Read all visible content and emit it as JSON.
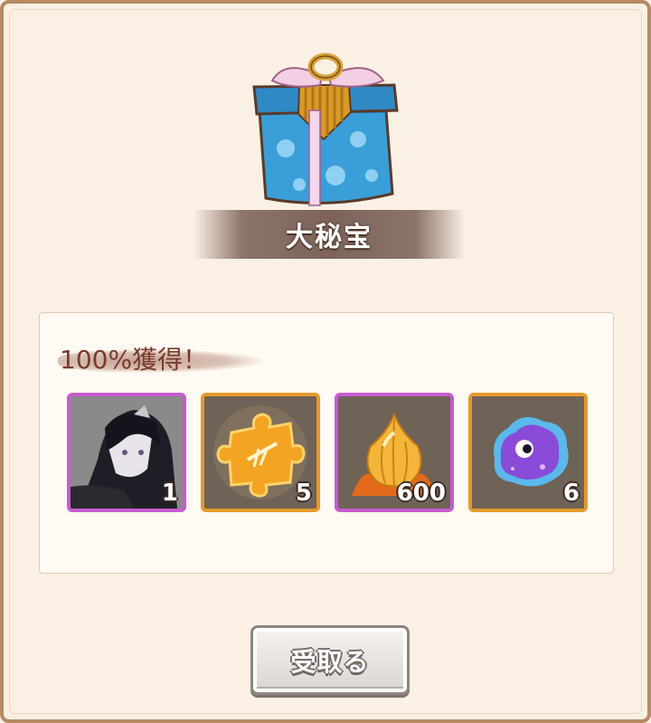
{
  "dialog": {
    "title": "大秘宝",
    "rate_label": "100%獲得！",
    "receive_label": "受取る"
  },
  "rewards": [
    {
      "name": "character-portrait",
      "frame": "purple",
      "count": "1"
    },
    {
      "name": "puzzle-piece",
      "frame": "orange",
      "count": "5"
    },
    {
      "name": "golden-onion",
      "frame": "purple",
      "count": "600"
    },
    {
      "name": "purple-slime",
      "frame": "orange",
      "count": "6"
    }
  ],
  "colors": {
    "purple_frame": "#c75bd1",
    "orange_frame": "#e49a2a",
    "title_banner": "#7d6359",
    "rate_text": "#7a3b2a"
  }
}
